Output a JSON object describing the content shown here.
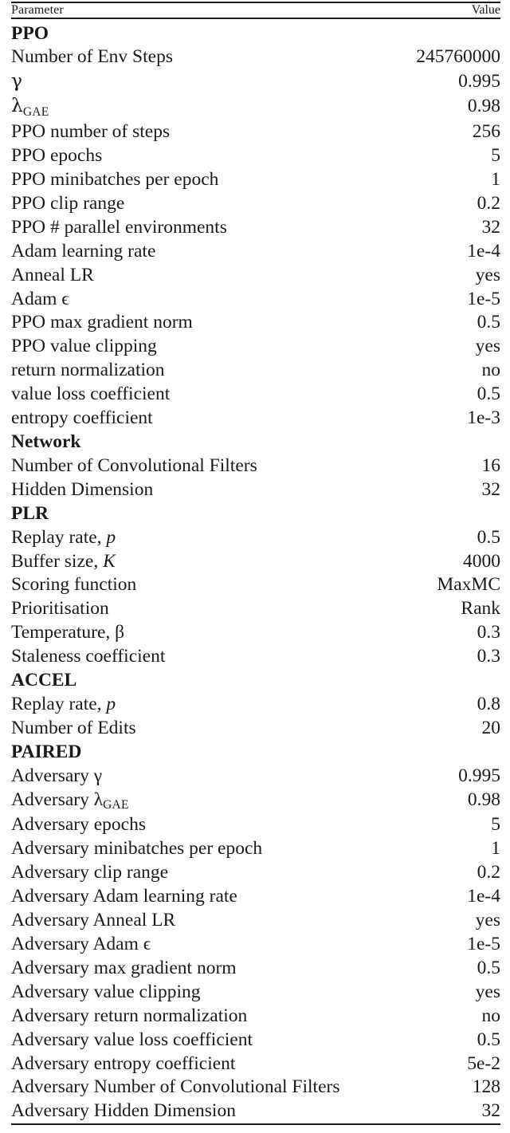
{
  "table": {
    "header": {
      "parameter_label": "Parameter",
      "value_label": "Value"
    },
    "rows": [
      {
        "type": "section",
        "key": "PPO",
        "value": ""
      },
      {
        "type": "row",
        "key": "Number of Env Steps",
        "value": "245760000"
      },
      {
        "type": "row",
        "key": "γ",
        "key_style": "greek",
        "value": "0.995"
      },
      {
        "type": "row",
        "key": "λ",
        "key_sub": "GAE",
        "key_style": "greek",
        "value": "0.98"
      },
      {
        "type": "row",
        "key": "PPO number of steps",
        "value": "256"
      },
      {
        "type": "row",
        "key": "PPO epochs",
        "value": "5"
      },
      {
        "type": "row",
        "key": "PPO minibatches per epoch",
        "value": "1"
      },
      {
        "type": "row",
        "key": "PPO clip range",
        "value": "0.2"
      },
      {
        "type": "row",
        "key": "PPO # parallel environments",
        "value": "32"
      },
      {
        "type": "row",
        "key": "Adam learning rate",
        "value": "1e-4"
      },
      {
        "type": "row",
        "key": "Anneal LR",
        "value": "yes"
      },
      {
        "type": "row",
        "key": "Adam ϵ",
        "value": "1e-5"
      },
      {
        "type": "row",
        "key": "PPO max gradient norm",
        "value": "0.5"
      },
      {
        "type": "row",
        "key": "PPO value clipping",
        "value": "yes"
      },
      {
        "type": "row",
        "key": "return normalization",
        "value": "no"
      },
      {
        "type": "row",
        "key": "value loss coefficient",
        "value": "0.5"
      },
      {
        "type": "row",
        "key": "entropy coefficient",
        "value": "1e-3"
      },
      {
        "type": "section",
        "key": "Network",
        "value": ""
      },
      {
        "type": "row",
        "key": "Number of Convolutional Filters",
        "value": "16"
      },
      {
        "type": "row",
        "key": "Hidden Dimension",
        "value": "32"
      },
      {
        "type": "section",
        "key": "PLR",
        "value": ""
      },
      {
        "type": "row",
        "key": "Replay rate, ",
        "key_math": "p",
        "value": "0.5"
      },
      {
        "type": "row",
        "key": "Buffer size, ",
        "key_math": "K",
        "value": "4000"
      },
      {
        "type": "row",
        "key": "Scoring function",
        "value": "MaxMC"
      },
      {
        "type": "row",
        "key": "Prioritisation",
        "value": "Rank"
      },
      {
        "type": "row",
        "key": "Temperature, β",
        "value": "0.3"
      },
      {
        "type": "row",
        "key": "Staleness coefficient",
        "value": "0.3"
      },
      {
        "type": "section",
        "key": "ACCEL",
        "value": ""
      },
      {
        "type": "row",
        "key": "Replay rate, ",
        "key_math": "p",
        "value": "0.8"
      },
      {
        "type": "row",
        "key": "Number of Edits",
        "value": "20"
      },
      {
        "type": "section",
        "key": "PAIRED",
        "value": ""
      },
      {
        "type": "row",
        "key": "Adversary γ",
        "value": "0.995"
      },
      {
        "type": "row",
        "key": "Adversary λ",
        "key_sub": "GAE",
        "value": "0.98"
      },
      {
        "type": "row",
        "key": "Adversary epochs",
        "value": "5"
      },
      {
        "type": "row",
        "key": "Adversary minibatches per epoch",
        "value": "1"
      },
      {
        "type": "row",
        "key": "Adversary clip range",
        "value": "0.2"
      },
      {
        "type": "row",
        "key": "Adversary Adam learning rate",
        "value": "1e-4"
      },
      {
        "type": "row",
        "key": "Adversary Anneal LR",
        "value": "yes"
      },
      {
        "type": "row",
        "key": "Adversary Adam ϵ",
        "value": "1e-5"
      },
      {
        "type": "row",
        "key": "Adversary max gradient norm",
        "value": "0.5"
      },
      {
        "type": "row",
        "key": "Adversary value clipping",
        "value": "yes"
      },
      {
        "type": "row",
        "key": "Adversary return normalization",
        "value": "no"
      },
      {
        "type": "row",
        "key": "Adversary value loss coefficient",
        "value": "0.5"
      },
      {
        "type": "row",
        "key": "Adversary entropy coefficient",
        "value": "5e-2"
      },
      {
        "type": "row",
        "key": "Adversary Number of Convolutional Filters",
        "value": "128"
      },
      {
        "type": "row",
        "key": "Adversary Hidden Dimension",
        "value": "32"
      }
    ]
  },
  "style": {
    "text_color": "#1a1a1a",
    "background": "#ffffff"
  }
}
